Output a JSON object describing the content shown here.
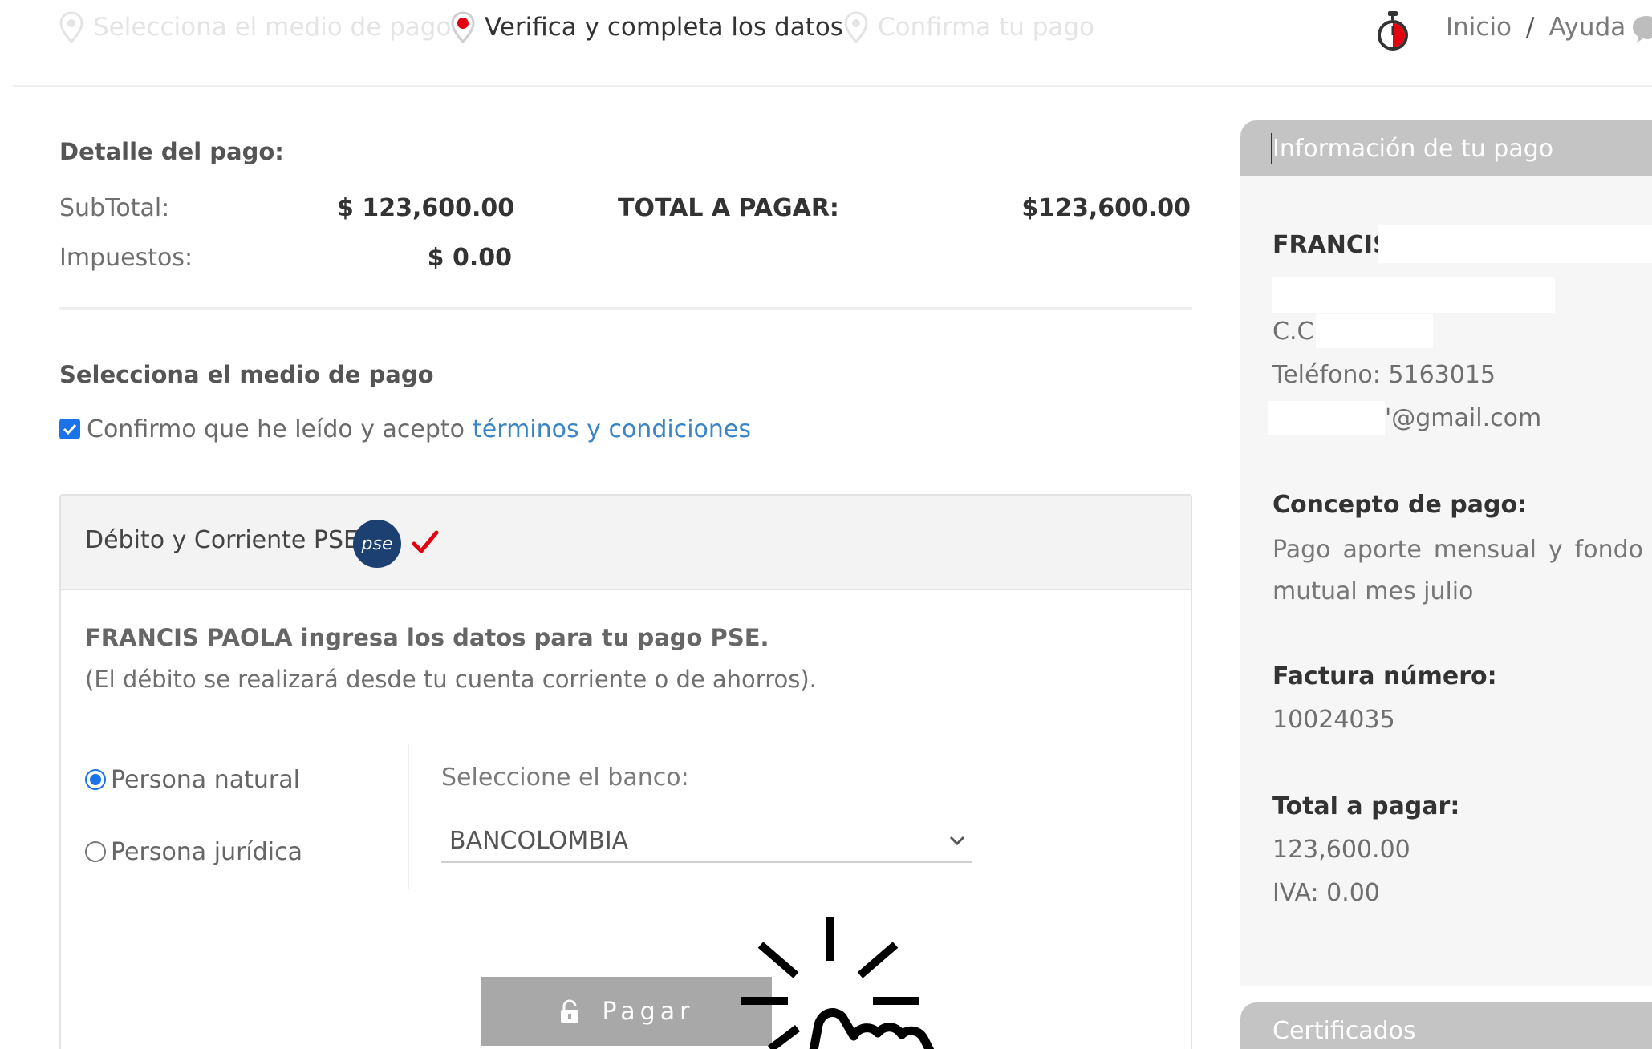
{
  "steps": [
    {
      "label": "Selecciona el medio de pago",
      "state": "inactive"
    },
    {
      "label": "Verifica y completa los datos",
      "state": "active"
    },
    {
      "label": "Confirma tu pago",
      "state": "inactive"
    }
  ],
  "topnav": {
    "home": "Inicio",
    "separator": "/",
    "help": "Ayuda"
  },
  "payment_detail": {
    "title": "Detalle del pago:",
    "subtotal_label": "SubTotal:",
    "subtotal_value": "$ 123,600.00",
    "taxes_label": "Impuestos:",
    "taxes_value": "$ 0.00",
    "total_label": "TOTAL A PAGAR:",
    "total_value": "$123,600.00"
  },
  "payment_method": {
    "title": "Selecciona el medio de pago",
    "terms_checked": true,
    "terms_text": "Confirmo que he leído y acepto",
    "terms_link": "términos y condiciones"
  },
  "pse": {
    "title": "Débito y Corriente PSE",
    "logo_text": "pse",
    "intro_bold": "FRANCIS PAOLA ingresa los datos para tu pago PSE.",
    "intro_note": "(El débito se realizará desde tu cuenta corriente o de ahorros).",
    "person_types": [
      {
        "label": "Persona natural",
        "selected": true
      },
      {
        "label": "Persona jurídica",
        "selected": false
      }
    ],
    "bank_label": "Seleccione el banco:",
    "bank_selected": "BANCOLOMBIA",
    "pay_label": "Pagar"
  },
  "info": {
    "title": "Información de tu pago",
    "name": "FRANCIS",
    "id_label": "C.C:",
    "phone": "Teléfono: 5163015",
    "email": "'@gmail.com",
    "concept_label": "Concepto de pago:",
    "concept_value": "Pago aporte mensual y fondo mutual mes julio",
    "invoice_label": "Factura número:",
    "invoice_value": "10024035",
    "total_label": "Total a pagar:",
    "total_value": "123,600.00",
    "iva": "IVA: 0.00"
  },
  "certificates": {
    "title": "Certificados"
  },
  "colors": {
    "accent_blue": "#1a73e8",
    "link_blue": "#3a85c6",
    "active_marker_red": "#e3000f",
    "panel_gray": "#c4c4c4",
    "button_gray": "#a8a8a8"
  }
}
